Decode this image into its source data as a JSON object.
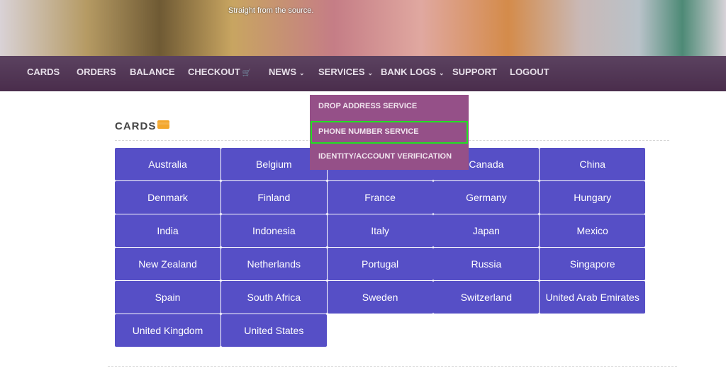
{
  "header": {
    "tagline": "Straight from the source."
  },
  "nav": [
    {
      "label": "CARDS"
    },
    {
      "label": "ORDERS"
    },
    {
      "label": "BALANCE"
    },
    {
      "label": "CHECKOUT",
      "icon": "cart-icon"
    },
    {
      "label": "NEWS",
      "dropdown": true
    },
    {
      "label": "SERVICES",
      "dropdown": true
    },
    {
      "label": "BANK LOGS",
      "dropdown": true
    },
    {
      "label": "SUPPORT"
    },
    {
      "label": "LOGOUT"
    }
  ],
  "services_menu": [
    "DROP ADDRESS SERVICE",
    "PHONE NUMBER SERVICE",
    "IDENTITY/ACCOUNT VERIFICATION"
  ],
  "highlighted_item": "PHONE NUMBER SERVICE",
  "section": {
    "title": "CARDS",
    "icon": "credit-card-icon"
  },
  "countries": [
    "Australia",
    "Belgium",
    "",
    "Canada",
    "China",
    "Denmark",
    "Finland",
    "France",
    "Germany",
    "Hungary",
    "India",
    "Indonesia",
    "Italy",
    "Japan",
    "Mexico",
    "New Zealand",
    "Netherlands",
    "Portugal",
    "Russia",
    "Singapore",
    "Spain",
    "South Africa",
    "Sweden",
    "Switzerland",
    "United Arab Emirates",
    "United Kingdom",
    "United States"
  ],
  "colors": {
    "nav": "#4a2d4c",
    "dropdown": "#955088",
    "button": "#564fc6",
    "highlight": "#22e022"
  }
}
